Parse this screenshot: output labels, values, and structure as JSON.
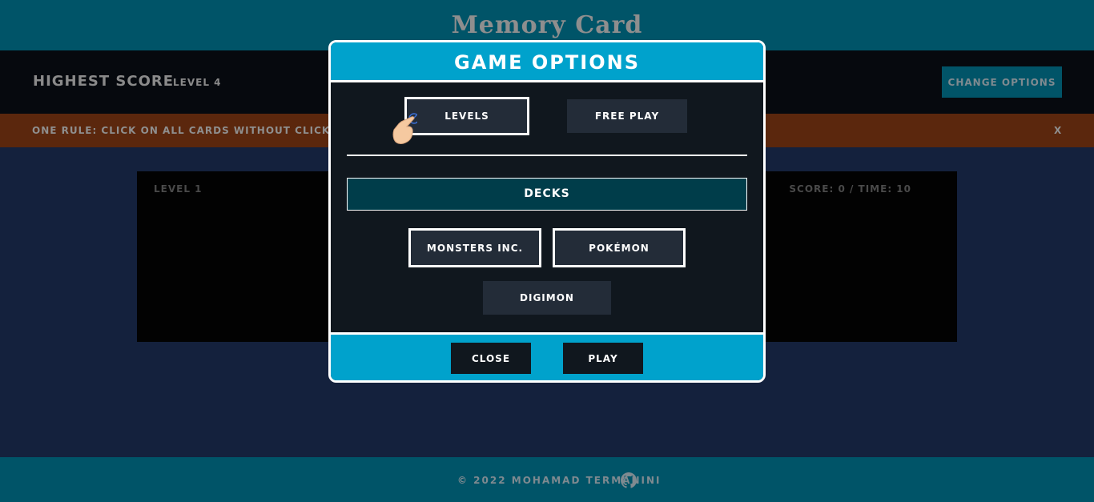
{
  "header": {
    "title": "Memory Card"
  },
  "topbar": {
    "highest_score_label": "HIGHEST SCORE",
    "highest_score_value": "LEVEL 4",
    "change_options_label": "CHANGE OPTIONS"
  },
  "rule": {
    "text": "ONE RULE: CLICK ON ALL CARDS WITHOUT CLICKING ANY",
    "close_label": "X"
  },
  "board": {
    "level_label": "LEVEL 1",
    "score_time": "SCORE: 0 / TIME: 10"
  },
  "modal": {
    "title": "GAME OPTIONS",
    "modes": [
      {
        "label": "LEVELS",
        "selected": true
      },
      {
        "label": "FREE PLAY",
        "selected": false
      }
    ],
    "decks_label": "DECKS",
    "decks": [
      {
        "label": "MONSTERS INC.",
        "selected": true
      },
      {
        "label": "POKÉMON",
        "selected": true
      },
      {
        "label": "DIGIMON",
        "selected": false
      }
    ],
    "close_label": "CLOSE",
    "play_label": "PLAY"
  },
  "footer": {
    "text": "© 2022 MOHAMAD TERMANINI"
  },
  "colors": {
    "header_bg": "#005468",
    "modal_accent": "#00a2cc",
    "rule_bg": "#5b270d",
    "page_bg": "#14213d"
  }
}
